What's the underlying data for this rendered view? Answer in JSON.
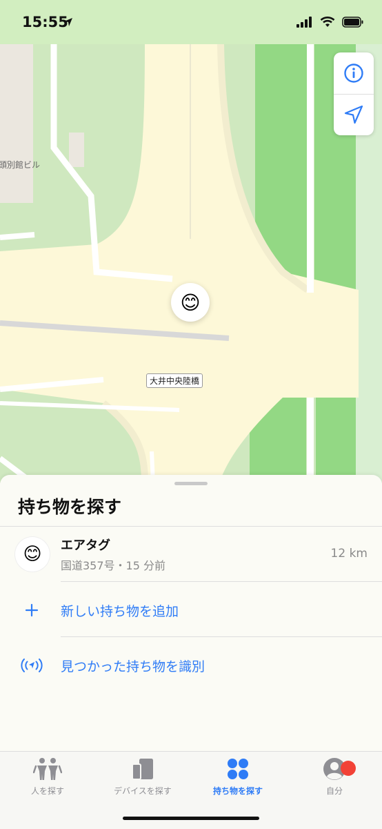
{
  "status_bar": {
    "time": "15:55"
  },
  "map": {
    "building_label": "頭別館ビル",
    "road_label": "大井中央陸橋",
    "pin_emoji": "😊",
    "controls": [
      "info-icon",
      "location-arrow-icon"
    ]
  },
  "sheet": {
    "title": "持ち物を探す",
    "item": {
      "emoji": "😊",
      "name": "エアタグ",
      "subtitle": "国道357号・15 分前",
      "distance": "12 km"
    },
    "actions": [
      {
        "icon": "plus-icon",
        "label": "新しい持ち物を追加"
      },
      {
        "icon": "identify-signal-icon",
        "label": "見つかった持ち物を識別"
      }
    ]
  },
  "tabs": [
    {
      "label": "人を探す",
      "icon": "people-icon",
      "active": false
    },
    {
      "label": "デバイスを探す",
      "icon": "devices-icon",
      "active": false
    },
    {
      "label": "持ち物を探す",
      "icon": "items-icon",
      "active": true
    },
    {
      "label": "自分",
      "icon": "me-icon",
      "active": false
    }
  ],
  "colors": {
    "accent": "#2f7cf6",
    "badge": "#f24236",
    "status_bg": "#d2eec0"
  }
}
